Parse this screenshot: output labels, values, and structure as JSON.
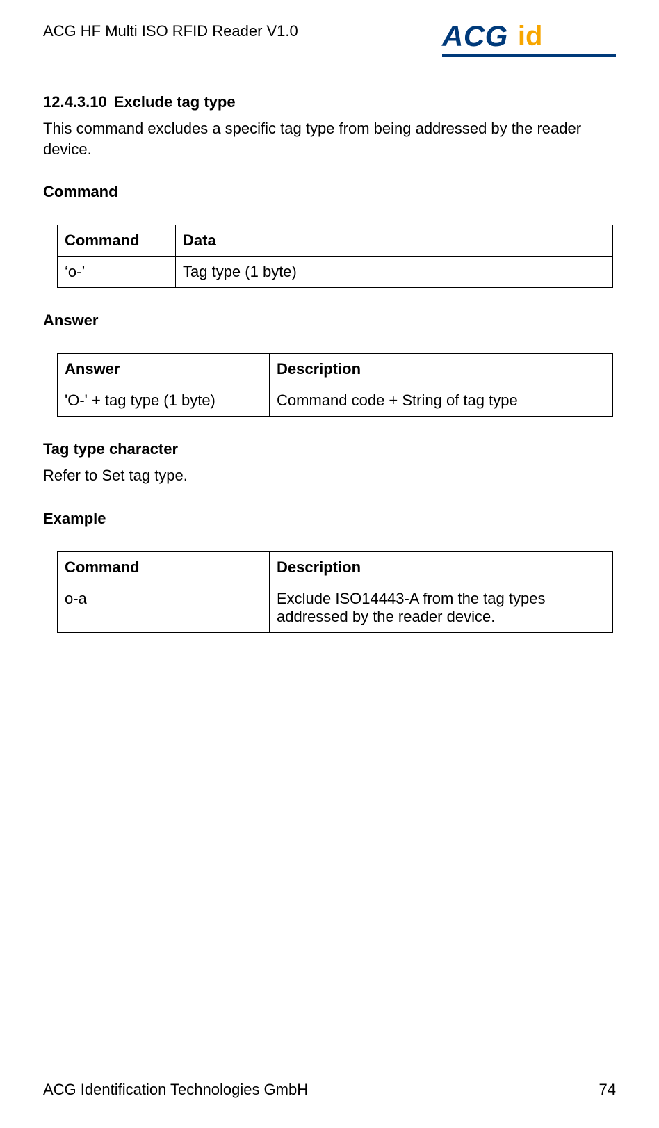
{
  "header": {
    "doc_title": "ACG HF Multi ISO RFID Reader V1.0",
    "logo_main": "ACG",
    "logo_sub": "id"
  },
  "section": {
    "number": "12.4.3.10",
    "title": "Exclude tag type",
    "intro": "This command excludes a specific tag type from being addressed by the reader device."
  },
  "command_block": {
    "heading": "Command",
    "th1": "Command",
    "th2": "Data",
    "cell1": "‘o-’",
    "cell2": "Tag type (1 byte)"
  },
  "answer_block": {
    "heading": "Answer",
    "th1": "Answer",
    "th2": "Description",
    "cell1": "'O-' + tag type (1 byte)",
    "cell2": "Command code + String of tag type"
  },
  "tagtype_block": {
    "heading": "Tag type character",
    "body": "Refer to Set tag type."
  },
  "example_block": {
    "heading": "Example",
    "th1": "Command",
    "th2": "Description",
    "cell1": "o-a",
    "cell2": "Exclude ISO14443-A from the tag types addressed by the reader device."
  },
  "footer": {
    "left": "ACG Identification Technologies GmbH",
    "right": "74"
  }
}
